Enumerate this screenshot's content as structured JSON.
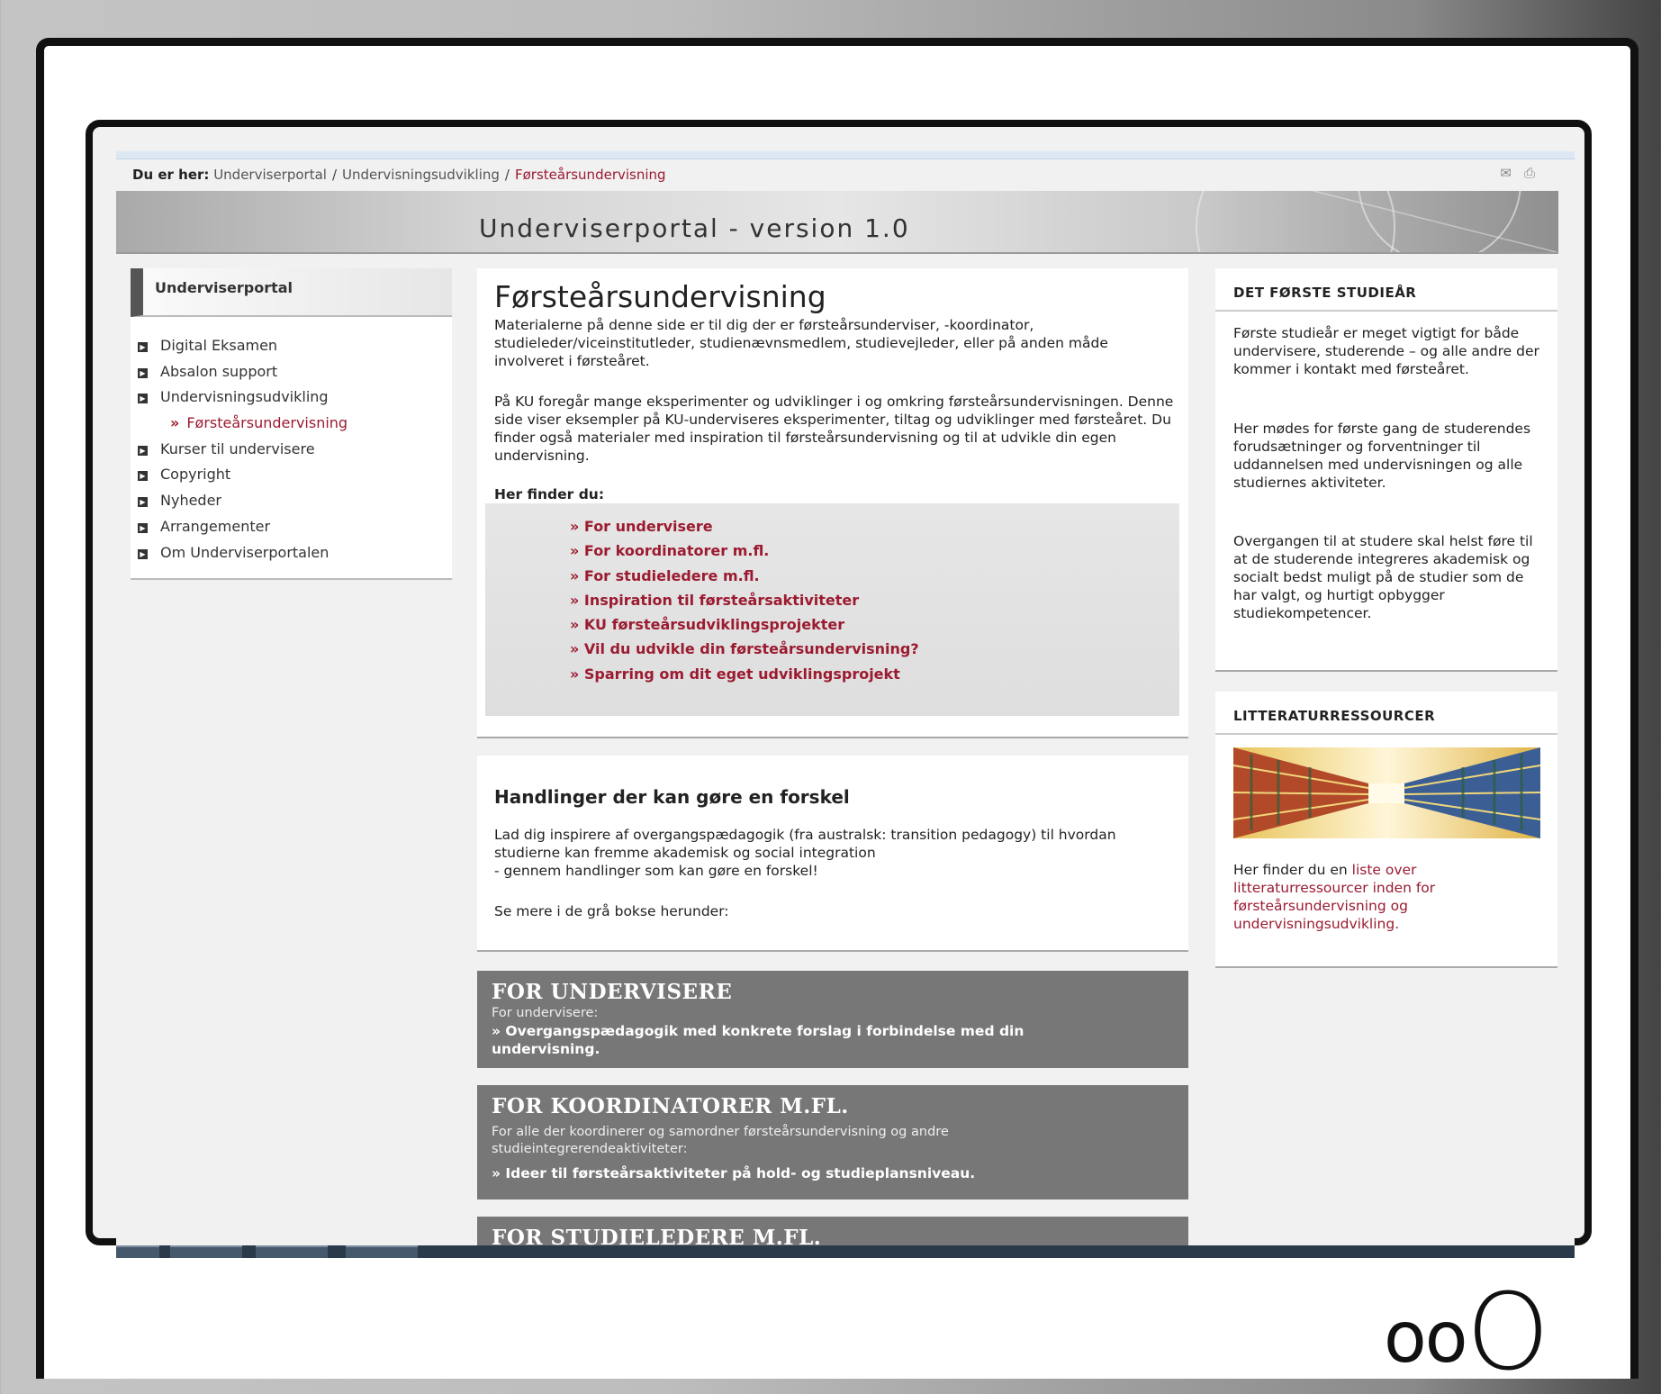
{
  "breadcrumb": {
    "prefix": "Du er her:",
    "items": [
      "Underviserportal",
      "Undervisningsudvikling",
      "Førsteårsundervisning"
    ],
    "separator": "/"
  },
  "banner": {
    "title": "Underviserportal - version 1.0"
  },
  "sidebar": {
    "title": "Underviserportal",
    "items": [
      {
        "label": "Digital Eksamen"
      },
      {
        "label": "Absalon support"
      },
      {
        "label": "Undervisningsudvikling"
      },
      {
        "label": "Førsteårsundervisning",
        "sub": true
      },
      {
        "label": "Kurser til undervisere"
      },
      {
        "label": "Copyright"
      },
      {
        "label": "Nyheder"
      },
      {
        "label": "Arrangementer"
      },
      {
        "label": "Om Underviserportalen"
      }
    ]
  },
  "main": {
    "title": "Førsteårsundervisning",
    "intro": "Materialerne på denne side er til dig der er førsteårsunderviser, -koordinator, studieleder/viceinstitutleder, studienævnsmedlem, studievejleder, eller på anden måde involveret i førsteåret.",
    "para2": "På KU foregår mange eksperimenter og udviklinger i og omkring førsteårsundervisningen. Denne side viser eksempler på KU-underviseres eksperimenter, tiltag og udviklinger med førsteåret. Du finder også materialer med inspiration til førsteårsundervisning og til at udvikle din egen undervisning.",
    "find_label": "Her finder du:",
    "links": [
      "» For undervisere",
      "» For koordinatorer m.fl.",
      "» For studieledere m.fl.",
      "» Inspiration til førsteårsaktiviteter",
      "» KU førsteårsudviklingsprojekter",
      "» Vil du udvikle din førsteårsundervisning?",
      "» Sparring om dit eget udviklingsprojekt"
    ]
  },
  "section2": {
    "title": "Handlinger der kan gøre en forskel",
    "text": "Lad dig inspirere af overgangspædagogik (fra australsk: transition pedagogy) til hvordan studierne kan fremme akademisk og social integration",
    "text2": "- gennem handlinger som kan gøre en forskel!",
    "text3": "Se mere i de grå bokse herunder:"
  },
  "gray_boxes": [
    {
      "title": "FOR UNDERVISERE",
      "sub": "For undervisere:",
      "link": "» Overgangspædagogik med konkrete forslag i forbindelse med din undervisning."
    },
    {
      "title": "FOR KOORDINATORER M.FL.",
      "sub": "For alle der koordinerer og samordner førsteårsundervisning og andre studieintegrerendeaktiviteter:",
      "link": "» Ideer til førsteårsaktiviteter på hold- og studieplansniveau."
    },
    {
      "title": "FOR STUDIELEDERE M.FL."
    }
  ],
  "right": {
    "box1": {
      "title": "DET FØRSTE STUDIEÅR",
      "p1": "Første studieår er meget vigtigt for både undervisere, studerende – og alle andre der kommer i kontakt med førsteåret.",
      "p2": "Her mødes for første gang de studerendes forudsætninger og forventninger til uddannelsen med undervisningen og alle studiernes aktiviteter.",
      "p3": "Overgangen til at studere skal helst føre til at de studerende integreres akademisk og socialt bedst muligt på de studier som de har valgt, og hurtigt opbygger studiekompetencer."
    },
    "box2": {
      "title": "LITTERATURRESSOURCER",
      "text_before": "Her finder du en ",
      "link": "liste over litteraturressourcer inden for førsteårsundervisning og undervisningsudvikling."
    }
  },
  "zoom_label_small": "oo",
  "zoom_label_big": "O",
  "colors": {
    "link": "#9b1b30",
    "gray_box": "#777777",
    "page_bg": "#f1f1f1"
  }
}
